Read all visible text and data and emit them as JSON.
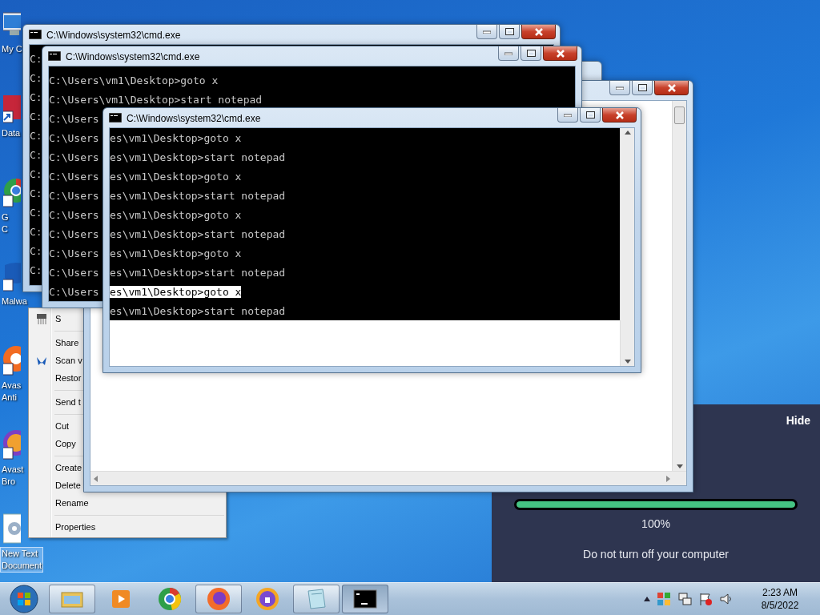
{
  "desktop_icons": [
    {
      "kind": "computer",
      "lines": [
        "My C"
      ],
      "selected": false
    },
    {
      "kind": "shortcut",
      "lines": [
        "Data"
      ],
      "selected": false
    },
    {
      "kind": "chrome",
      "lines": [
        "G",
        "C"
      ],
      "selected": false
    },
    {
      "kind": "shield",
      "lines": [
        "Malwa"
      ],
      "selected": false
    },
    {
      "kind": "avast",
      "lines": [
        "Avas",
        "Anti"
      ],
      "selected": false
    },
    {
      "kind": "browser",
      "lines": [
        "Avast",
        "Bro"
      ],
      "selected": false
    },
    {
      "kind": "document",
      "lines": [
        "New Text",
        "Document"
      ],
      "selected": true
    }
  ],
  "context_menu": {
    "items": [
      {
        "kind": "item",
        "label": "S"
      },
      {
        "kind": "separator"
      },
      {
        "kind": "item",
        "label": "Share"
      },
      {
        "kind": "item",
        "label": "Scan v"
      },
      {
        "kind": "item",
        "label": "Restor"
      },
      {
        "kind": "separator"
      },
      {
        "kind": "item",
        "label": "Send t"
      },
      {
        "kind": "separator"
      },
      {
        "kind": "item",
        "label": "Cut"
      },
      {
        "kind": "item",
        "label": "Copy"
      },
      {
        "kind": "separator"
      },
      {
        "kind": "item",
        "label": "Create"
      },
      {
        "kind": "item",
        "label": "Delete"
      },
      {
        "kind": "item",
        "label": "Rename"
      },
      {
        "kind": "separator"
      },
      {
        "kind": "item",
        "label": "Properties"
      }
    ]
  },
  "windows": [
    {
      "kind": "console",
      "title": "C:\\Windows\\system32\\cmd.exe",
      "lines": [
        {
          "text": "C:",
          "selected": false
        },
        {
          "text": "C:",
          "selected": false
        },
        {
          "text": "C:",
          "selected": false
        },
        {
          "text": "C:",
          "selected": false
        },
        {
          "text": "C:",
          "selected": false
        },
        {
          "text": "C:",
          "selected": false
        },
        {
          "text": "C:",
          "selected": false
        },
        {
          "text": "C:",
          "selected": false
        },
        {
          "text": "C:",
          "selected": false
        },
        {
          "text": "C:",
          "selected": false
        },
        {
          "text": "C:",
          "selected": false
        },
        {
          "text": "C:",
          "selected": false
        }
      ]
    },
    {
      "kind": "frame"
    },
    {
      "kind": "editor"
    },
    {
      "kind": "console",
      "title": "C:\\Windows\\system32\\cmd.exe",
      "lines": [
        {
          "text": "C:\\Users\\vm1\\Desktop>goto x",
          "selected": false
        },
        {
          "text": "C:\\Users\\vm1\\Desktop>start notepad",
          "selected": false
        },
        {
          "text": "C:\\Users",
          "selected": false
        },
        {
          "text": "C:\\Users",
          "selected": false
        },
        {
          "text": "C:\\Users",
          "selected": false
        },
        {
          "text": "C:\\Users",
          "selected": false
        },
        {
          "text": "C:\\Users",
          "selected": false
        },
        {
          "text": "C:\\Users",
          "selected": false
        },
        {
          "text": "C:\\Users",
          "selected": false
        },
        {
          "text": "C:\\Users",
          "selected": false
        },
        {
          "text": "C:\\Users",
          "selected": false
        },
        {
          "text": "C:\\Users",
          "selected": false
        }
      ]
    },
    {
      "kind": "console",
      "title": "C:\\Windows\\system32\\cmd.exe",
      "lines": [
        {
          "text": "es\\vm1\\Desktop>goto x",
          "selected": false
        },
        {
          "text": "es\\vm1\\Desktop>start notepad",
          "selected": false
        },
        {
          "text": "es\\vm1\\Desktop>goto x",
          "selected": false
        },
        {
          "text": "es\\vm1\\Desktop>start notepad",
          "selected": false
        },
        {
          "text": "es\\vm1\\Desktop>goto x",
          "selected": false
        },
        {
          "text": "es\\vm1\\Desktop>start notepad",
          "selected": false
        },
        {
          "text": "es\\vm1\\Desktop>goto x",
          "selected": false
        },
        {
          "text": "es\\vm1\\Desktop>start notepad",
          "selected": false
        },
        {
          "text": "es\\vm1\\Desktop>goto x",
          "selected": true
        },
        {
          "text": "es\\vm1\\Desktop>start notepad",
          "selected": false
        }
      ]
    }
  ],
  "update": {
    "hide": "Hide",
    "level": 1,
    "percent": "100%",
    "message": "Do not turn off your computer"
  },
  "taskbar": {
    "apps": [
      {
        "kind": "explorer",
        "open": true,
        "selected": false
      },
      {
        "kind": "media",
        "open": false,
        "selected": false
      },
      {
        "kind": "chrome",
        "open": false,
        "selected": false
      },
      {
        "kind": "firefox",
        "open": true,
        "selected": false
      },
      {
        "kind": "browser",
        "open": false,
        "selected": false
      },
      {
        "kind": "notepad",
        "open": true,
        "selected": false
      },
      {
        "kind": "console",
        "open": true,
        "selected": true
      }
    ],
    "time": "2:23 AM",
    "date": "8/5/2022"
  }
}
